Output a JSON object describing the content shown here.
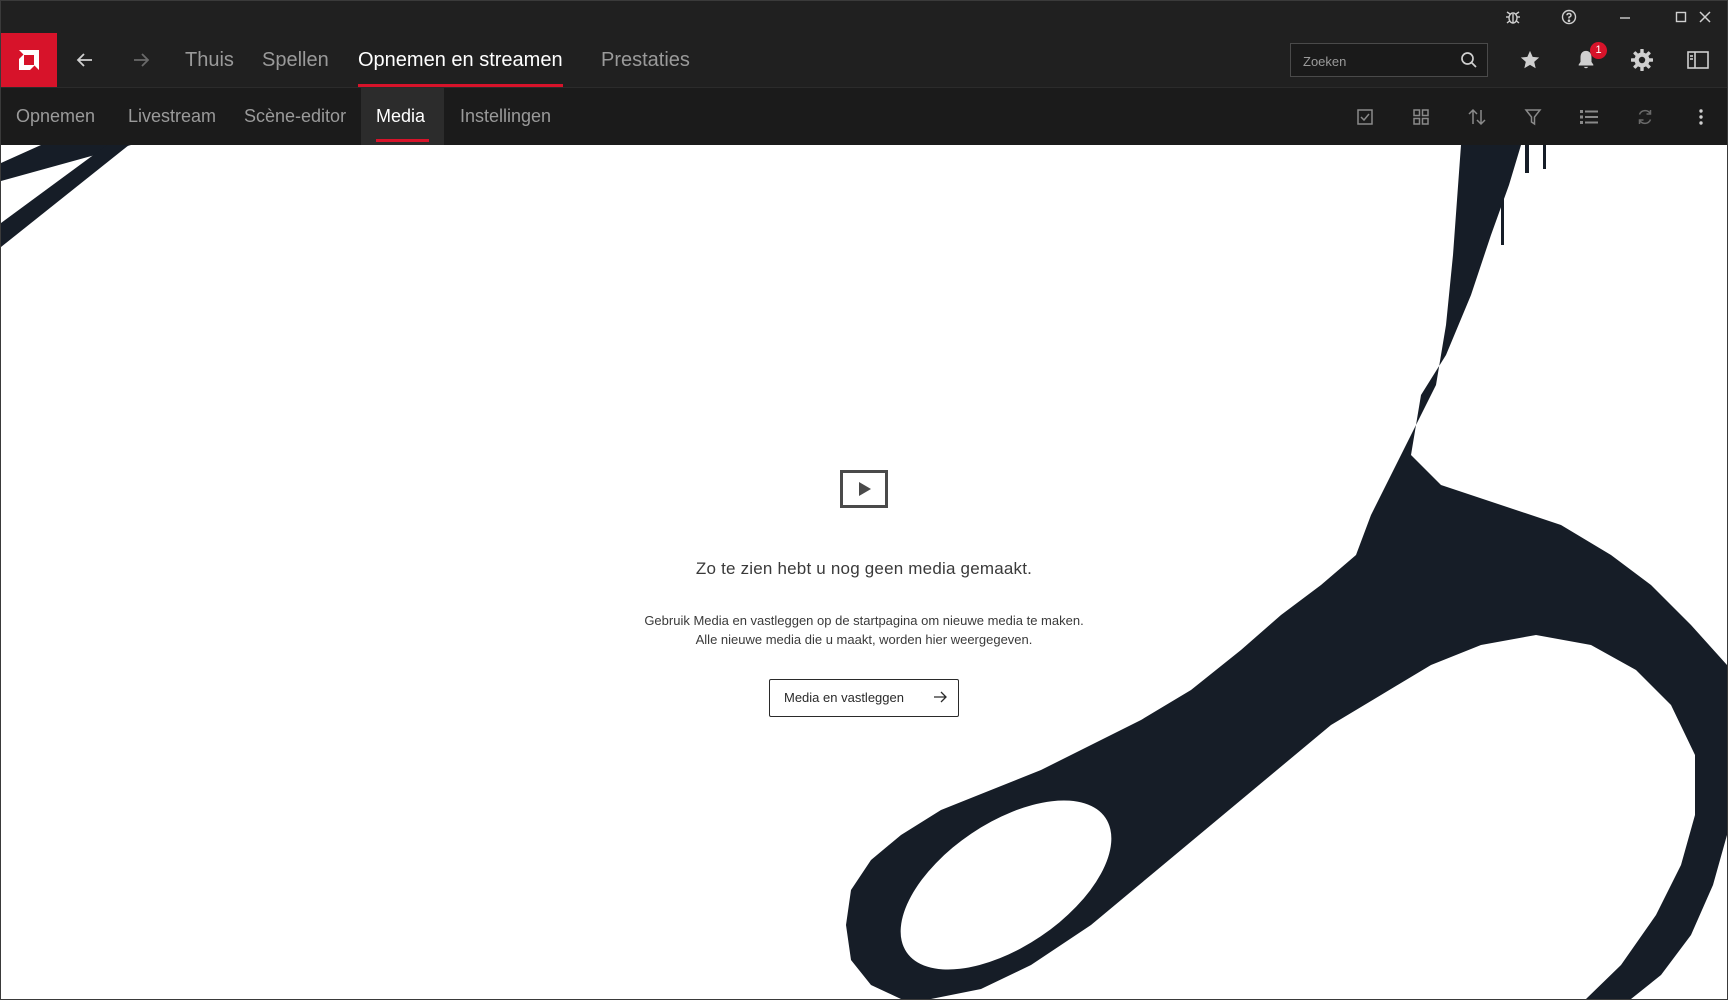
{
  "app": {
    "brand_color": "#d7132a",
    "bg_dark": "#202020"
  },
  "titlebar": {
    "icons": [
      "bug-icon",
      "help-icon",
      "minimize-icon",
      "maximize-icon",
      "close-icon"
    ]
  },
  "nav": {
    "tabs": [
      {
        "label": "Thuis",
        "active": false
      },
      {
        "label": "Spellen",
        "active": false
      },
      {
        "label": "Opnemen en streamen",
        "active": true
      },
      {
        "label": "Prestaties",
        "active": false
      }
    ],
    "search": {
      "placeholder": "Zoeken",
      "value": ""
    },
    "notifications_count": "1"
  },
  "subnav": {
    "tabs": [
      {
        "label": "Opnemen",
        "active": false
      },
      {
        "label": "Livestream",
        "active": false
      },
      {
        "label": "Scène-editor",
        "active": false
      },
      {
        "label": "Media",
        "active": true
      },
      {
        "label": "Instellingen",
        "active": false
      }
    ],
    "tools": [
      "select-icon",
      "grid-view-icon",
      "sort-icon",
      "filter-icon",
      "list-view-icon",
      "refresh-icon",
      "more-icon"
    ]
  },
  "empty_state": {
    "title": "Zo te zien hebt u nog geen media gemaakt.",
    "desc_line1": "Gebruik Media en vastleggen op de startpagina om nieuwe media te maken.",
    "desc_line2": "Alle nieuwe media die u maakt, worden hier weergegeven.",
    "button_label": "Media en vastleggen"
  }
}
